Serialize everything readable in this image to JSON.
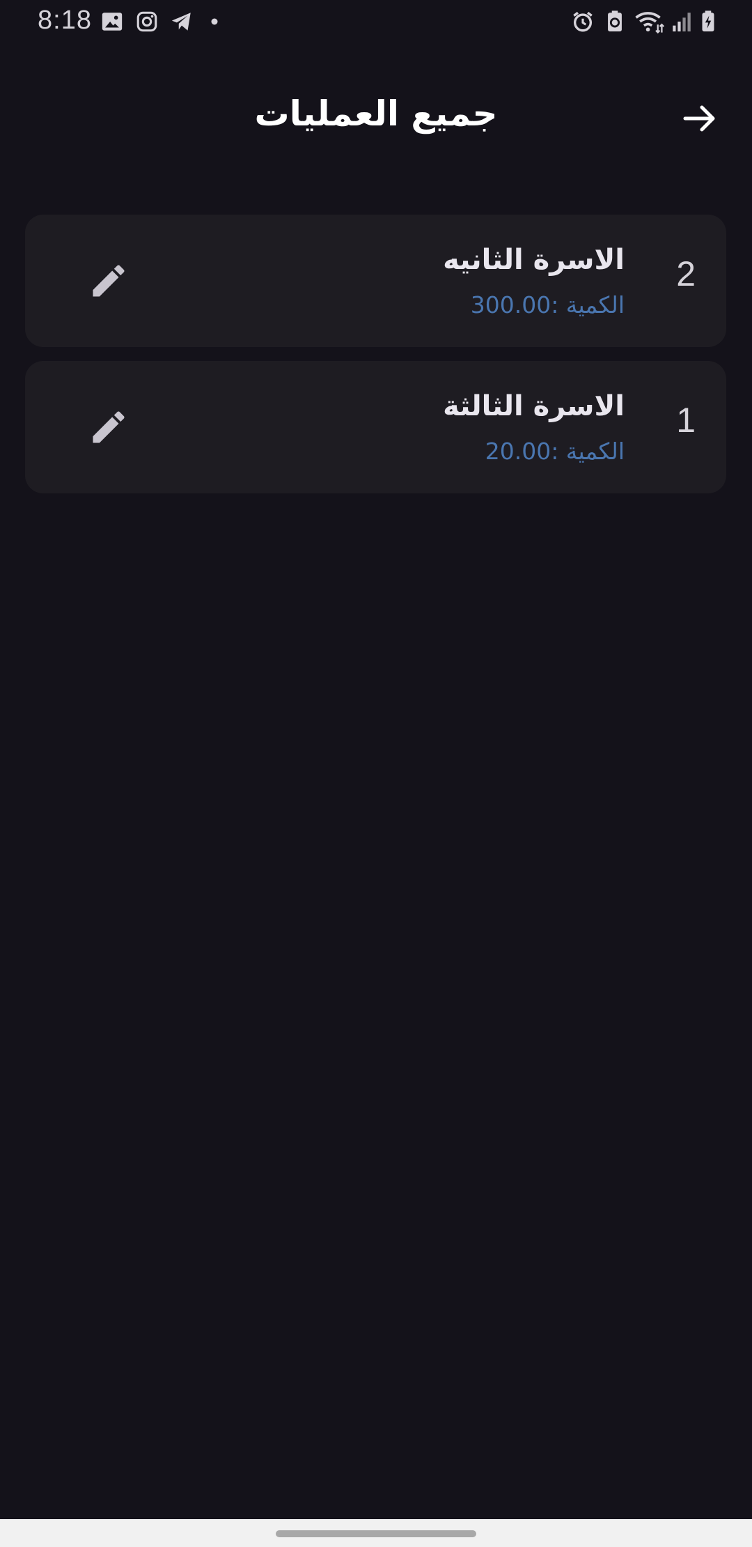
{
  "status_bar": {
    "time": "8:18",
    "left_icons": [
      "gallery-icon",
      "instagram-icon",
      "telegram-icon",
      "dot-icon"
    ],
    "right_icons": [
      "alarm-icon",
      "battery-saver-icon",
      "wifi-icon",
      "signal-icon",
      "battery-charging-icon"
    ]
  },
  "header": {
    "title": "جميع العمليات",
    "back_icon": "arrow-right-icon"
  },
  "items": [
    {
      "number": "2",
      "title": "الاسرة الثانيه",
      "subtitle": "الكمية :300.00",
      "action_icon": "pencil-icon"
    },
    {
      "number": "1",
      "title": "الاسرة الثالثة",
      "subtitle": "الكمية :20.00",
      "action_icon": "pencil-icon"
    }
  ],
  "colors": {
    "background": "#14121a",
    "card": "#1e1c22",
    "accent": "#4a76b0",
    "text": "#e9e6ee"
  }
}
